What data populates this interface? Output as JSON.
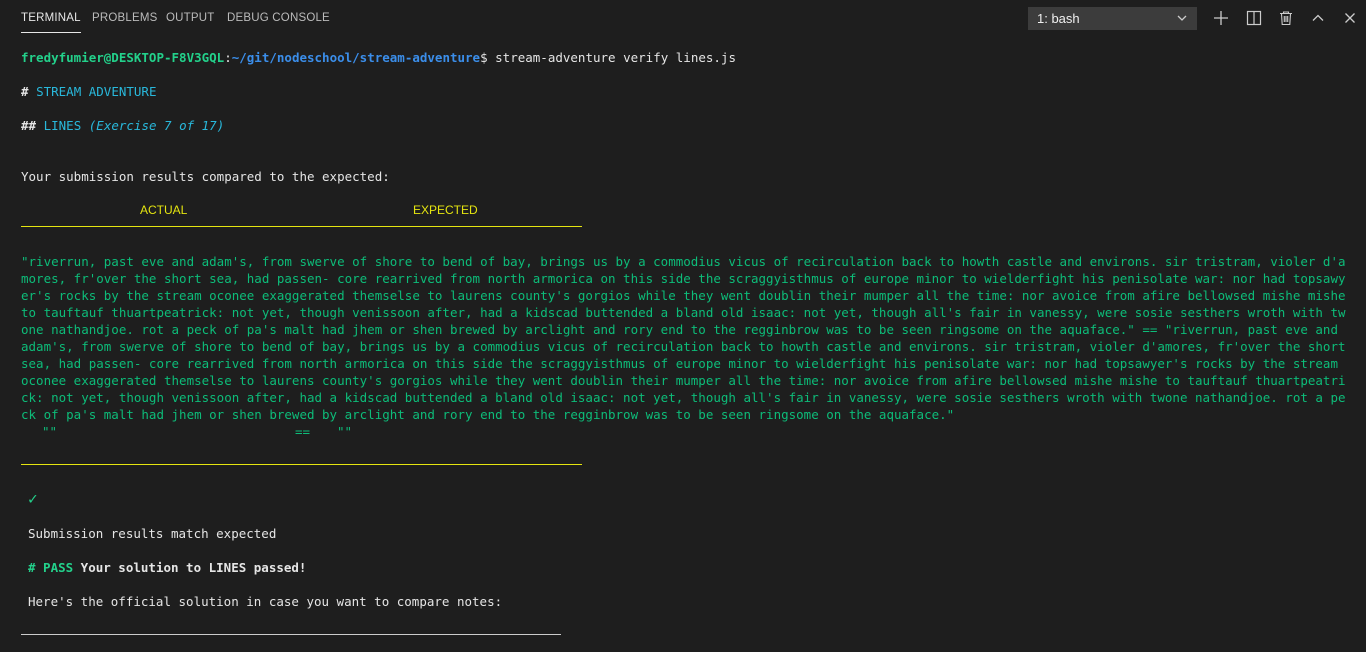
{
  "tabs": [
    {
      "label": "TERMINAL",
      "active": true
    },
    {
      "label": "PROBLEMS",
      "active": false
    },
    {
      "label": "OUTPUT",
      "active": false
    },
    {
      "label": "DEBUG CONSOLE",
      "active": false
    }
  ],
  "terminal_select": {
    "value": "1: bash"
  },
  "icons": {
    "new": "plus-icon",
    "split": "split-icon",
    "kill": "trash-icon",
    "maximize": "chevron-up-icon",
    "close": "close-icon"
  },
  "prompt": {
    "user_host": "fredyfumier@DESKTOP-F8V3GQL",
    "colon": ":",
    "path": "~/git/nodeschool/stream-adventure",
    "dollar": "$",
    "command": " stream-adventure verify lines.js"
  },
  "heading1": {
    "hash": "#",
    "text": "STREAM ADVENTURE"
  },
  "heading2": {
    "hash": "##",
    "title": "LINES",
    "exercise": "(Exercise 7 of 17)"
  },
  "compare_text": "Your submission results compared to the expected:",
  "columns": {
    "actual": "ACTUAL",
    "expected": "EXPECTED"
  },
  "output_text": "   \"riverrun, past eve and adam's, from swerve of shore to bend of bay, brings us by a commodius vicus of recirculation back to    howth castle and environs. sir tristram, violer d'amores, fr'over the short sea, had passen- core rearrived from north armorica on this side the scraggyisthmus of europe minor to wielderfight his penisolate war: nor    had topsawyer's rocks by the stream oconee exaggerated themselse   to laurens county's gorgios while they went doublin their mumper   all the time: nor avoice from afire bellowsed mishe mishe to   tauftauf thuartpeatrick: not yet, though venissoon after, had a   kidscad buttended a bland old isaac: not yet, though all's fair in    vanessy, were sosie sesthers wroth with twone nathandjoe. rot a   peck of pa's malt had jhem or shen brewed by arclight and rory    end to the regginbrow was to be seen ringsome on the aquaface.\" ==    \"riverrun, past eve and adam's, from swerve of shore to bend of bay, brings us by a commodius vicus of recirculation back to    howth castle and environs. sir tristram, violer d'amores, fr'over the short sea, had passen- core rearrived from north armorica on this side the scraggyisthmus of europe minor to wielderfight his penisolate war: nor    had topsawyer's rocks by the stream oconee exaggerated themselse   to laurens county's gorgios while they went doublin their mumper   all the time: nor avoice from afire bellowsed mishe mishe to   tauftauf thuartpeatrick: not yet, though venissoon after, had a   kidscad buttended a bland old isaac: not yet, though all's fair in    vanessy, were sosie sesthers wroth with twone nathandjoe. rot a   peck of pa's malt had jhem or shen brewed by arclight and rory    end to the regginbrow was to be seen ringsome on the aquaface.\"",
  "empty_line": {
    "left": "\"\"",
    "eq": "==",
    "right": "\"\""
  },
  "checkmark": "✓",
  "match_text": "Submission results match expected",
  "pass": {
    "label": "# PASS",
    "text": " Your solution to LINES passed!"
  },
  "solution_text": "Here's the official solution in case you want to compare notes:",
  "colors": {
    "background": "#1e1e1e",
    "green": "#0dbc79",
    "bright_green": "#23d18b",
    "yellow": "#e5e510",
    "blue": "#3b8eea",
    "cyan": "#29b8db"
  }
}
